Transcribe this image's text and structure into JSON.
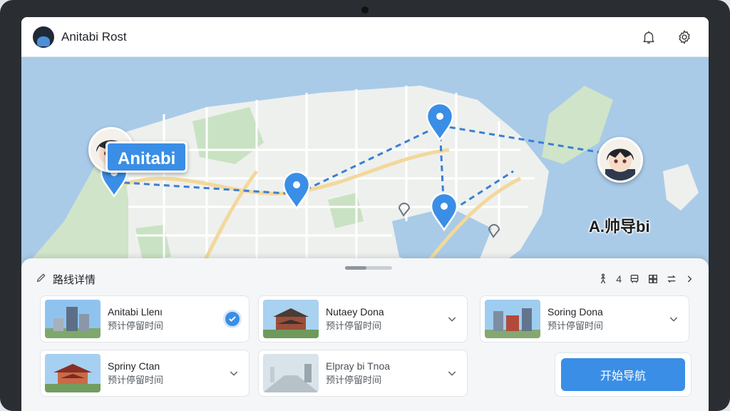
{
  "app": {
    "title": "Anitabi Rost",
    "icons": [
      "app-logo-icon",
      "bell-icon",
      "gear-icon"
    ]
  },
  "map": {
    "label_left": "Anitabi",
    "label_right": "A.帅导bi",
    "pins": 5,
    "colors": {
      "water": "#a9cbe8",
      "land": "#eef0ee",
      "park": "#c9e2c3",
      "road": "#ffffff",
      "major_road": "#f2d89b",
      "route": "#3a7fd4",
      "pin": "#3a8ee6"
    }
  },
  "panel": {
    "title": "路线详情",
    "edit_icon": "pencil-icon",
    "stats": [
      {
        "icon": "walk-icon",
        "value": ""
      },
      {
        "icon": "",
        "value": "4"
      },
      {
        "icon": "bus-icon",
        "value": ""
      },
      {
        "icon": "grid-icon",
        "value": ""
      },
      {
        "icon": "swap-icon",
        "value": ""
      }
    ],
    "stat_text": "4",
    "chevron_icon": "chevron-right-icon"
  },
  "stops": [
    {
      "name": "Anitabi Llenı",
      "sub": "预计停留时间",
      "state": "checked"
    },
    {
      "name": "Nutaey Dona",
      "sub": "预计停留时间",
      "state": "collapsed"
    },
    {
      "name": "Soring Dona",
      "sub": "预计停留时间",
      "state": "collapsed"
    },
    {
      "name": "Spriny Ctan",
      "sub": "预计停留时间",
      "state": "collapsed"
    },
    {
      "name": "Elpray bi Tnoa",
      "sub": "预计停留时间",
      "state": "collapsed"
    }
  ],
  "actions": {
    "start_navigation": "开始导航"
  }
}
